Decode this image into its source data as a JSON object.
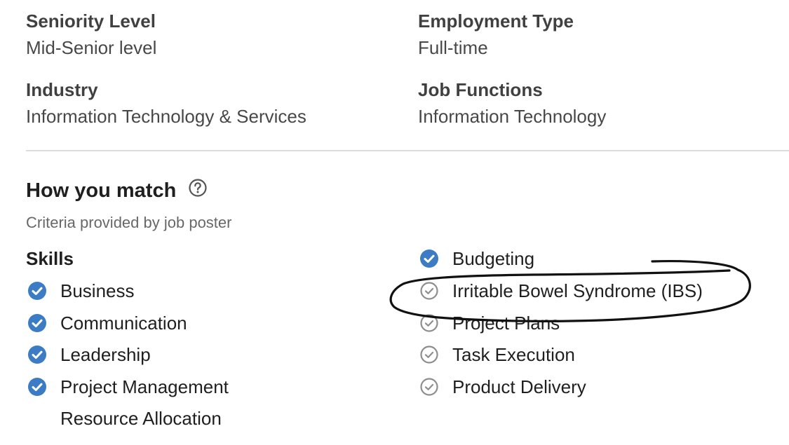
{
  "criteria": {
    "seniority": {
      "label": "Seniority Level",
      "value": "Mid-Senior level"
    },
    "employment": {
      "label": "Employment Type",
      "value": "Full-time"
    },
    "industry": {
      "label": "Industry",
      "value": "Information Technology & Services"
    },
    "functions": {
      "label": "Job Functions",
      "value": "Information Technology"
    }
  },
  "match": {
    "title": "How you match",
    "help_icon": "question-circle-icon",
    "subtitle": "Criteria provided by job poster",
    "skills_heading": "Skills",
    "left_skills": [
      {
        "label": "Business",
        "matched": true
      },
      {
        "label": "Communication",
        "matched": true
      },
      {
        "label": "Leadership",
        "matched": true
      },
      {
        "label": "Project Management",
        "matched": true
      },
      {
        "label": "Resource Allocation",
        "matched": false,
        "icon_hidden": true
      }
    ],
    "right_skills": [
      {
        "label": "Budgeting",
        "matched": true
      },
      {
        "label": "Irritable Bowel Syndrome (IBS)",
        "matched": false
      },
      {
        "label": "Project Plans",
        "matched": false
      },
      {
        "label": "Task Execution",
        "matched": false
      },
      {
        "label": "Product Delivery",
        "matched": false
      }
    ]
  },
  "colors": {
    "matched_check": "#3b7cc4",
    "unmatched_check": "#8e8e8e",
    "divider": "#dcdcdc",
    "annotation_ink": "#111111"
  },
  "annotation": {
    "type": "hand-drawn-circle",
    "encircles": "Irritable Bowel Syndrome (IBS)"
  }
}
